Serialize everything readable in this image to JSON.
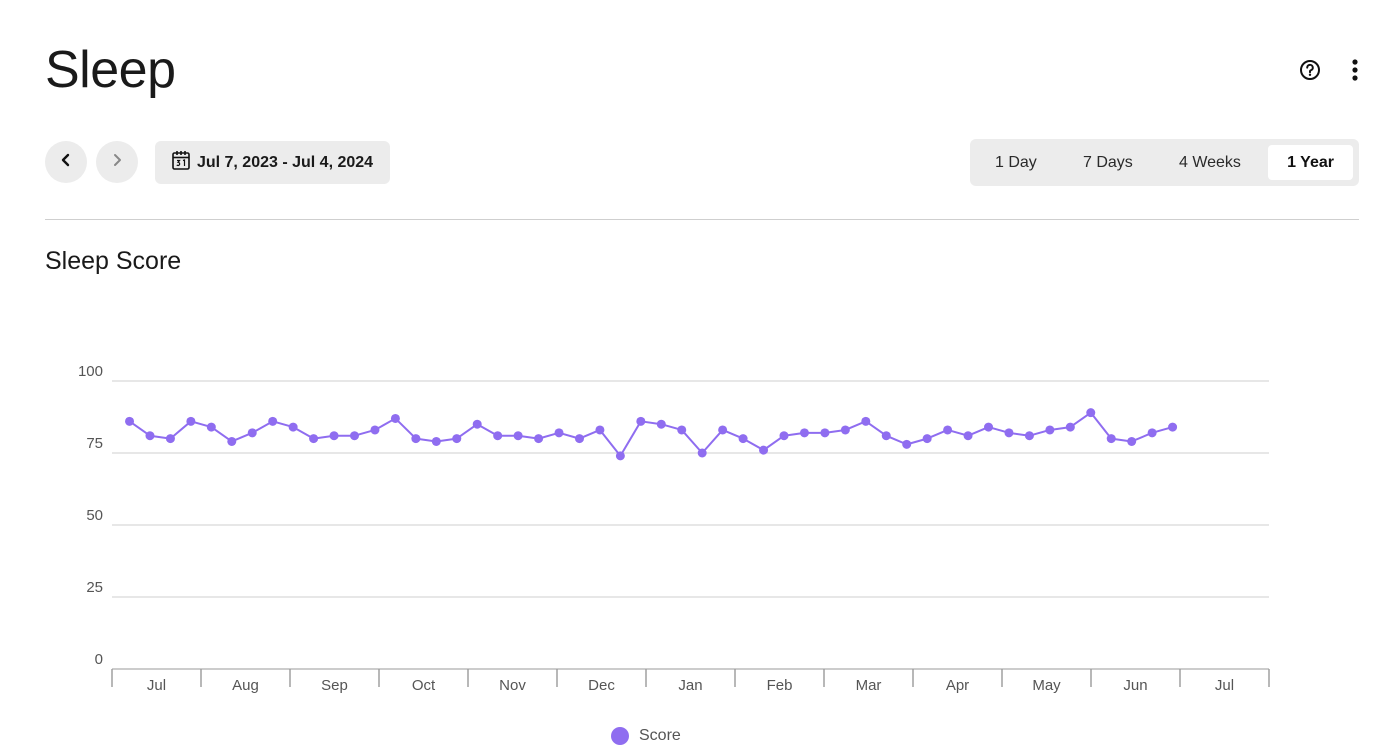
{
  "header": {
    "title": "Sleep"
  },
  "icons": {
    "help": "help-circle-icon",
    "more": "more-vertical-icon",
    "prev": "chevron-left-icon",
    "next": "chevron-right-icon",
    "calendar": "calendar-icon"
  },
  "date_range": {
    "label": "Jul 7, 2023 - Jul 4, 2024"
  },
  "period_tabs": [
    {
      "label": "1 Day",
      "active": false
    },
    {
      "label": "7 Days",
      "active": false
    },
    {
      "label": "4 Weeks",
      "active": false
    },
    {
      "label": "1 Year",
      "active": true
    }
  ],
  "section": {
    "title": "Sleep Score"
  },
  "colors": {
    "series": "#8f6df0",
    "grid": "#cfcfcf",
    "axis": "#9a9a9a",
    "tick_text": "#555555"
  },
  "chart_data": {
    "type": "line",
    "title": "Sleep Score",
    "xlabel": "",
    "ylabel": "",
    "ylim": [
      0,
      100
    ],
    "yticks": [
      0,
      25,
      50,
      75,
      100
    ],
    "xlim": [
      "2023-07-01",
      "2024-07-31"
    ],
    "month_ticks": [
      "Jul",
      "Aug",
      "Sep",
      "Oct",
      "Nov",
      "Dec",
      "Jan",
      "Feb",
      "Mar",
      "Apr",
      "May",
      "Jun",
      "Jul"
    ],
    "grid": true,
    "legend": "bottom-center",
    "series": [
      {
        "name": "Score",
        "x": [
          "2023-07-07",
          "2023-07-14",
          "2023-07-21",
          "2023-07-28",
          "2023-08-04",
          "2023-08-11",
          "2023-08-18",
          "2023-08-25",
          "2023-09-01",
          "2023-09-08",
          "2023-09-15",
          "2023-09-22",
          "2023-09-29",
          "2023-10-06",
          "2023-10-13",
          "2023-10-20",
          "2023-10-27",
          "2023-11-03",
          "2023-11-10",
          "2023-11-17",
          "2023-11-24",
          "2023-12-01",
          "2023-12-08",
          "2023-12-15",
          "2023-12-22",
          "2023-12-29",
          "2024-01-05",
          "2024-01-12",
          "2024-01-19",
          "2024-01-26",
          "2024-02-02",
          "2024-02-09",
          "2024-02-16",
          "2024-02-23",
          "2024-03-01",
          "2024-03-08",
          "2024-03-15",
          "2024-03-22",
          "2024-03-29",
          "2024-04-05",
          "2024-04-12",
          "2024-04-19",
          "2024-04-26",
          "2024-05-03",
          "2024-05-10",
          "2024-05-17",
          "2024-05-24",
          "2024-05-31",
          "2024-06-07",
          "2024-06-14",
          "2024-06-21",
          "2024-06-28"
        ],
        "values": [
          86,
          81,
          80,
          86,
          84,
          79,
          82,
          86,
          84,
          80,
          81,
          81,
          83,
          87,
          80,
          79,
          80,
          85,
          81,
          81,
          80,
          82,
          80,
          83,
          74,
          86,
          85,
          83,
          75,
          83,
          80,
          76,
          81,
          82,
          82,
          83,
          86,
          81,
          78,
          80,
          83,
          81,
          84,
          82,
          81,
          83,
          84,
          89,
          80,
          79,
          82,
          84
        ]
      }
    ]
  }
}
